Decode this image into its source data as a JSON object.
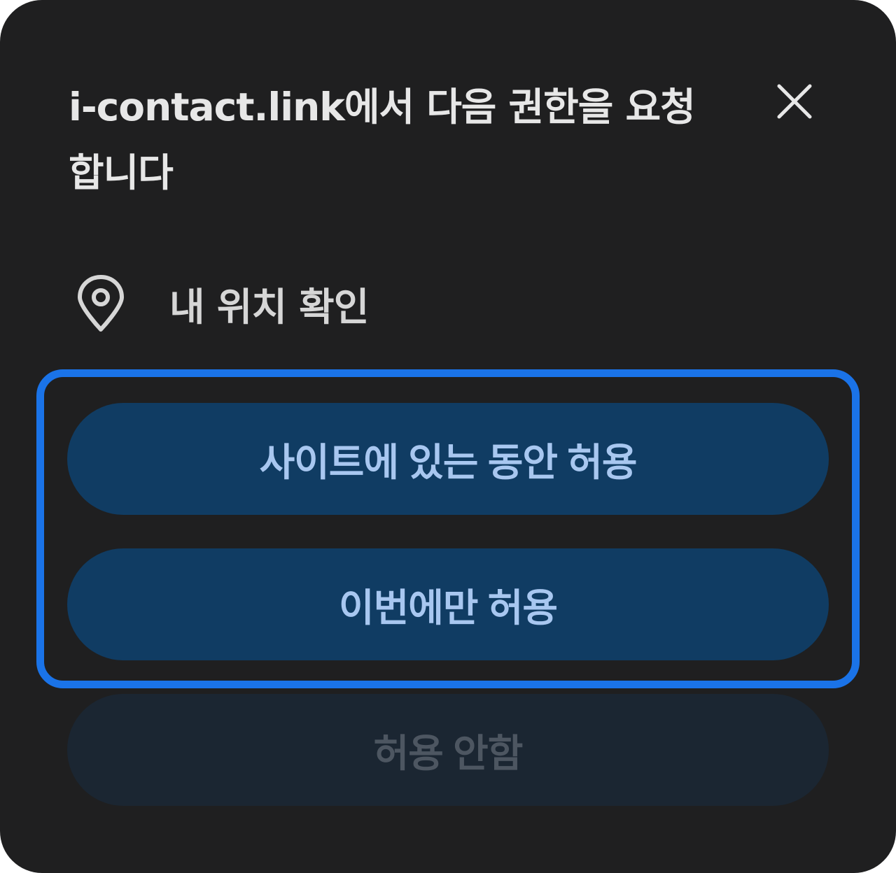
{
  "dialog": {
    "title": "i-contact.link에서 다음 권한을 요청합니다",
    "close_icon": "close-icon",
    "permission": {
      "icon": "location-pin-icon",
      "label": "내 위치 확인"
    },
    "buttons": {
      "allow_while_visiting": "사이트에 있는 동안 허용",
      "allow_this_time": "이번에만 허용",
      "deny": "허용 안함"
    },
    "colors": {
      "background": "#1f1f20",
      "focus_ring": "#1a73e8",
      "button_primary_bg": "#103c63",
      "button_primary_text": "#a8c7f0",
      "button_disabled_bg": "#1b2632",
      "button_disabled_text": "#4d5661"
    }
  }
}
